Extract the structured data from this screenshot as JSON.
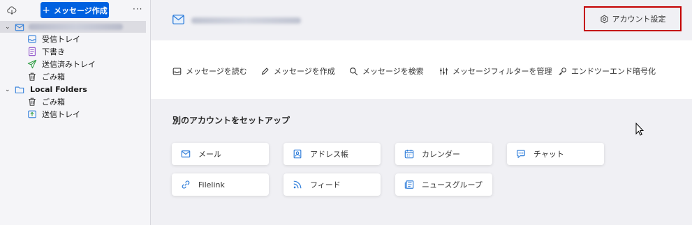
{
  "sidebar": {
    "compose_label": "メッセージ作成",
    "more_label": "···",
    "account_label": "",
    "folders": [
      {
        "label": "受信トレイ",
        "icon": "inbox-icon"
      },
      {
        "label": "下書き",
        "icon": "draft-icon"
      },
      {
        "label": "送信済みトレイ",
        "icon": "sent-icon"
      },
      {
        "label": "ごみ箱",
        "icon": "trash-icon"
      }
    ],
    "local_folders_label": "Local Folders",
    "local_folders": [
      {
        "label": "ごみ箱",
        "icon": "trash-icon"
      },
      {
        "label": "送信トレイ",
        "icon": "outbox-icon"
      }
    ]
  },
  "header": {
    "email": "",
    "account_settings_label": "アカウント設定"
  },
  "actions": [
    {
      "label": "メッセージを読む",
      "icon": "read-icon"
    },
    {
      "label": "メッセージを作成",
      "icon": "pencil-icon"
    },
    {
      "label": "メッセージを検索",
      "icon": "search-icon"
    },
    {
      "label": "メッセージフィルターを管理",
      "icon": "filter-icon"
    },
    {
      "label": "エンドツーエンド暗号化",
      "icon": "key-icon"
    }
  ],
  "setup": {
    "title": "別のアカウントをセットアップ",
    "cards": [
      {
        "label": "メール",
        "icon": "envelope-icon"
      },
      {
        "label": "アドレス帳",
        "icon": "address-book-icon"
      },
      {
        "label": "カレンダー",
        "icon": "calendar-icon"
      },
      {
        "label": "チャット",
        "icon": "chat-icon"
      },
      {
        "label": "Filelink",
        "icon": "link-icon"
      },
      {
        "label": "フィード",
        "icon": "rss-icon"
      },
      {
        "label": "ニュースグループ",
        "icon": "newsgroup-icon"
      }
    ]
  },
  "colors": {
    "accent": "#0061e0",
    "highlight_border": "#c40000",
    "icon_blue": "#2b7bd9"
  }
}
